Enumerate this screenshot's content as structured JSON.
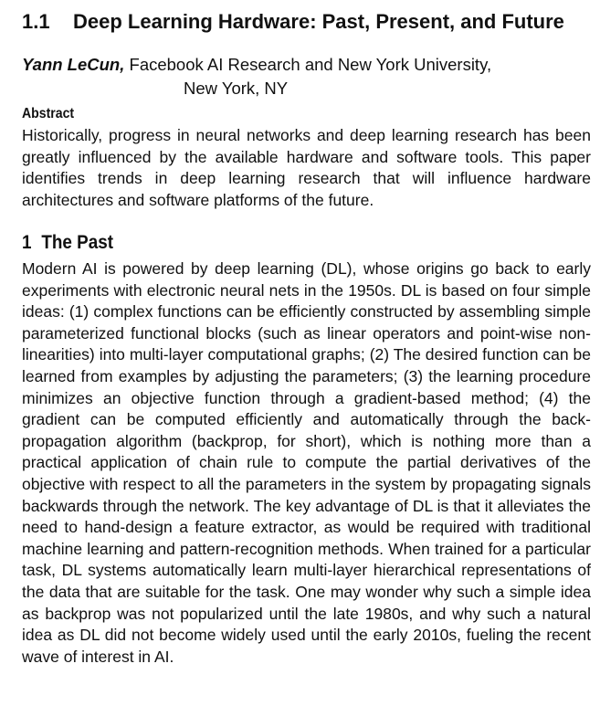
{
  "header": {
    "section_number": "1.1",
    "title": "Deep Learning Hardware: Past, Present, and Future"
  },
  "author": {
    "name": "Yann LeCun,",
    "affiliation_line1": " Facebook AI Research and New York University,",
    "affiliation_line2": "New York, NY"
  },
  "abstract": {
    "heading": "Abstract",
    "text": "Historically, progress in neural networks and deep learning research has been greatly influenced by the available hardware and software tools. This paper identifies trends in deep learning research that will influence hardware architectures and software platforms of the future."
  },
  "section_past": {
    "number": "1",
    "title": "The Past",
    "body": "Modern AI is powered by deep learning (DL), whose origins go back to early experiments with electronic neural nets in the 1950s. DL is based on four simple ideas: (1) complex functions can be efficiently constructed by assembling simple parameterized functional blocks (such as linear operators and point-wise non-linearities) into multi-layer computational graphs; (2) The desired function can be learned from examples by adjusting the parameters; (3) the learning procedure minimizes an objective function through a gradient-based method; (4) the gradient can be computed efficiently and automatically through the back-propagation algorithm (backprop, for short), which is nothing more than a practical application of chain rule to compute the partial derivatives of the objective with respect to all the parameters in the system by propagating signals backwards through the network. The key advantage of DL is that it alleviates the need to hand-design a feature ex­tractor, as would be required with traditional machine learning and pattern-recognition methods. When trained for a particular task, DL systems auto­matically learn multi-layer hierarchical representations of the data that are suitable for the task. One may wonder why such a simple idea as backprop was not popularized until the late 1980s, and why such a natural idea as DL did not become widely used until the early 2010s, fueling the recent wave of interest in AI."
  }
}
